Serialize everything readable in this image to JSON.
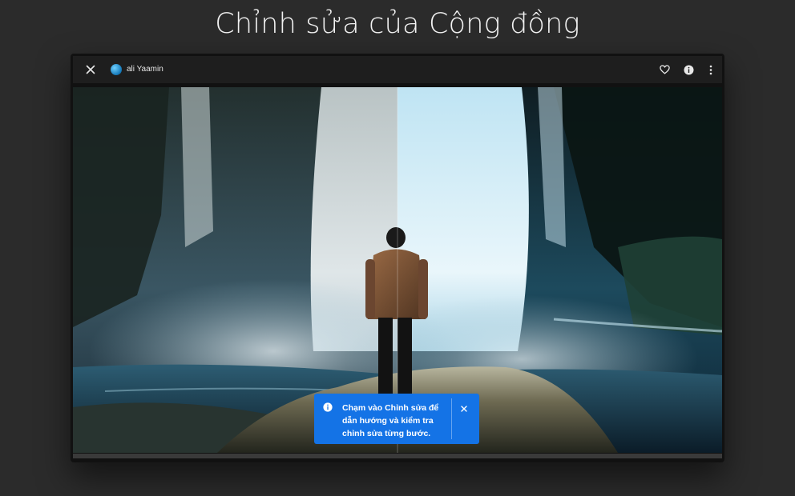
{
  "headline": "Chỉnh sửa của Cộng đồng",
  "topbar": {
    "user_name": "ali Yaamin",
    "icons": [
      "close-icon",
      "heart-icon",
      "info-icon",
      "more-vertical-icon"
    ]
  },
  "photo": {
    "description_icon": "photo-before-after"
  },
  "tooltip": {
    "text": "Chạm vào Chỉnh sửa để dẫn hướng và kiểm tra chỉnh sửa từng bước.",
    "icons": [
      "info-icon",
      "close-icon"
    ]
  },
  "colors": {
    "background": "#2b2b2b",
    "accent_blue": "#1473e6",
    "topbar": "#1e1e1e"
  }
}
